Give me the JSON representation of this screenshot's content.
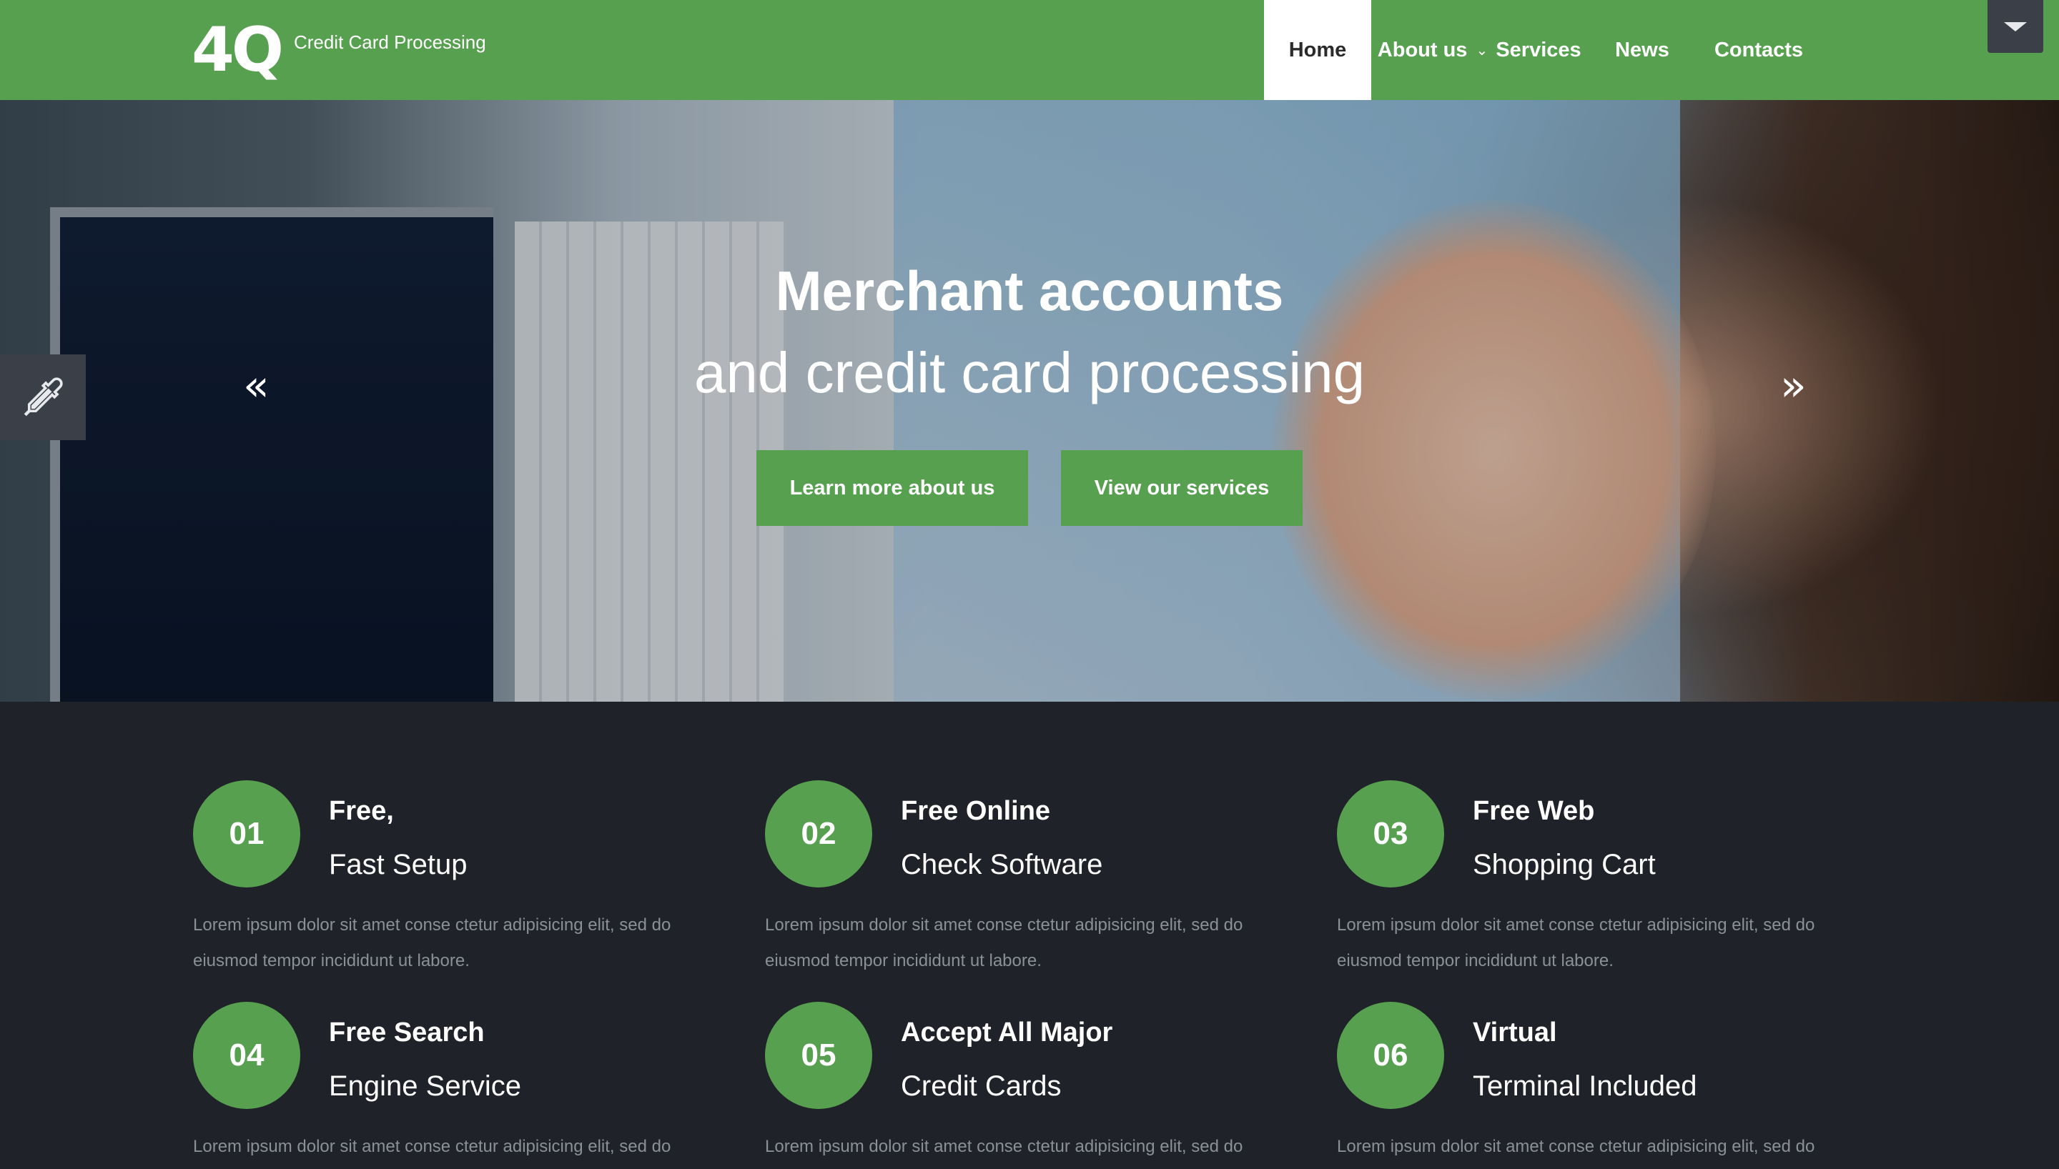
{
  "brand": {
    "logo": "4Q",
    "tagline": "Credit Card Processing"
  },
  "nav": {
    "home": "Home",
    "about": "About us",
    "services": "Services",
    "news": "News",
    "contacts": "Contacts",
    "active": "Home"
  },
  "hero": {
    "title": "Merchant accounts",
    "subtitle": "and credit card processing",
    "btn_learn": "Learn more about us",
    "btn_services": "View our services",
    "prev": "«",
    "next": "»"
  },
  "features": [
    {
      "num": "01",
      "title1": "Free,",
      "title2": "Fast Setup",
      "text": "Lorem ipsum dolor sit amet conse ctetur adipisicing elit, sed do eiusmod tempor incididunt ut labore."
    },
    {
      "num": "02",
      "title1": "Free Online",
      "title2": "Check Software",
      "text": "Lorem ipsum dolor sit amet conse ctetur adipisicing elit, sed do eiusmod tempor incididunt ut labore."
    },
    {
      "num": "03",
      "title1": "Free Web",
      "title2": "Shopping Cart",
      "text": "Lorem ipsum dolor sit amet conse ctetur adipisicing elit, sed do eiusmod tempor incididunt ut labore."
    },
    {
      "num": "04",
      "title1": "Free Search",
      "title2": "Engine Service",
      "text": "Lorem ipsum dolor sit amet conse ctetur adipisicing elit, sed do"
    },
    {
      "num": "05",
      "title1": "Accept All Major",
      "title2": "Credit Cards",
      "text": "Lorem ipsum dolor sit amet conse ctetur adipisicing elit, sed do"
    },
    {
      "num": "06",
      "title1": "Virtual",
      "title2": "Terminal Included",
      "text": "Lorem ipsum dolor sit amet conse ctetur adipisicing elit, sed do"
    }
  ],
  "colors": {
    "brand_green": "#57a04f",
    "dark_bg": "#1f2228",
    "panel": "#3b4048"
  },
  "icons": {
    "toggle": "caret-down-icon",
    "picker": "eyedropper-icon"
  }
}
